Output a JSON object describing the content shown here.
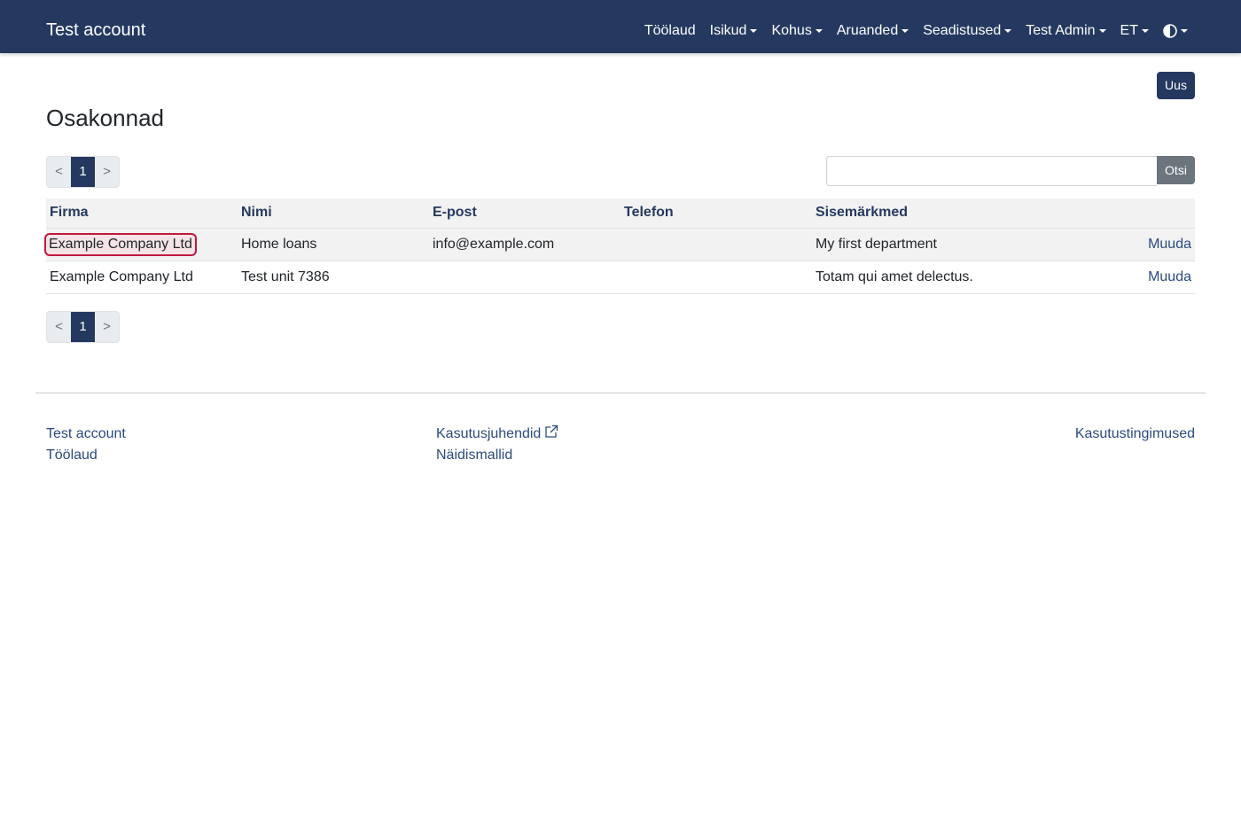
{
  "navbar": {
    "brand": "Test account",
    "items": [
      {
        "label": "Töölaud",
        "dropdown": false
      },
      {
        "label": "Isikud",
        "dropdown": true
      },
      {
        "label": "Kohus",
        "dropdown": true
      },
      {
        "label": "Aruanded",
        "dropdown": true
      },
      {
        "label": "Seadistused",
        "dropdown": true
      },
      {
        "label": "Test Admin",
        "dropdown": true
      },
      {
        "label": "ET",
        "dropdown": true
      }
    ],
    "theme_icon": "contrast-half-circle-icon"
  },
  "actions": {
    "new_label": "Uus"
  },
  "page": {
    "title": "Osakonnad"
  },
  "pagination": {
    "prev": "<",
    "current": "1",
    "next": ">"
  },
  "search": {
    "value": "",
    "button_label": "Otsi"
  },
  "table": {
    "headers": [
      "Firma",
      "Nimi",
      "E-post",
      "Telefon",
      "Sisemärkmed",
      ""
    ],
    "rows": [
      {
        "firma": "Example Company Ltd",
        "nimi": "Home loans",
        "epost": "info@example.com",
        "telefon": "",
        "sisemarkmed": "My first department",
        "action": "Muuda"
      },
      {
        "firma": "Example Company Ltd",
        "nimi": "Test unit 7386",
        "epost": "",
        "telefon": "",
        "sisemarkmed": "Totam qui amet delectus.",
        "action": "Muuda"
      }
    ]
  },
  "footer": {
    "col1": [
      "Test account",
      "Töölaud"
    ],
    "col2": [
      "Kasutusjuhendid",
      "Näidismallid"
    ],
    "col3": [
      "Kasutustingimused"
    ]
  },
  "colors": {
    "primary": "#253960",
    "link": "#2c4a80",
    "highlight_border": "#c0193c"
  }
}
